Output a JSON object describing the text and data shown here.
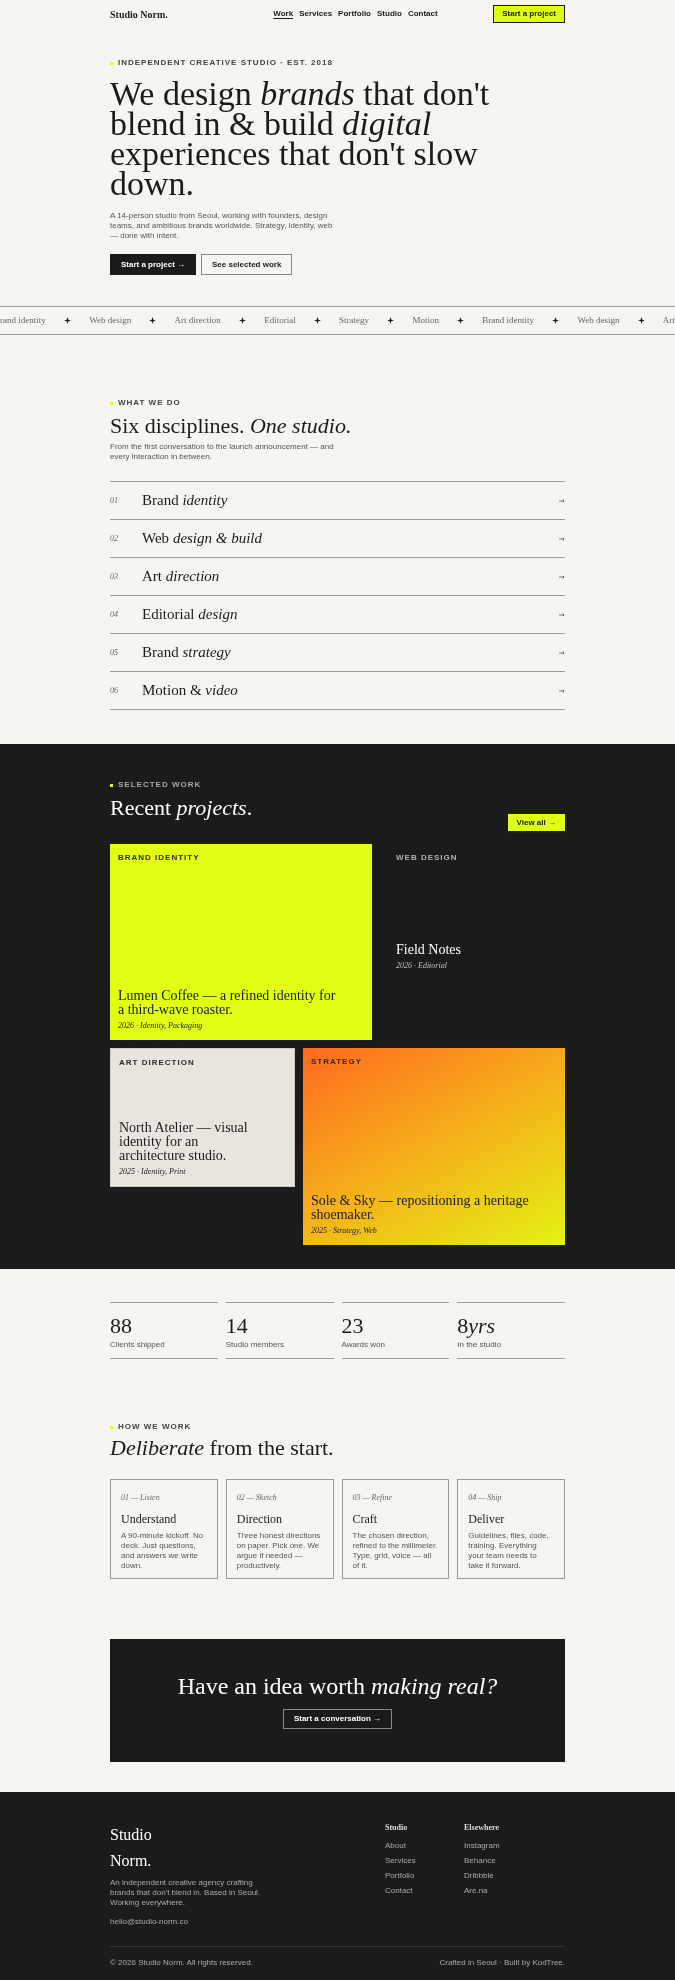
{
  "nav": {
    "logo": "Studio Norm.",
    "links": [
      {
        "label": "Work",
        "selected": true
      },
      {
        "label": "Services",
        "selected": false
      },
      {
        "label": "Portfolio",
        "selected": false
      },
      {
        "label": "Studio",
        "selected": false
      },
      {
        "label": "Contact",
        "selected": false
      }
    ],
    "cta": "Start a project"
  },
  "hero": {
    "eyebrow": "INDEPENDENT CREATIVE STUDIO · EST. 2018",
    "heading": "We design *brands* that don't blend in & build *digital* experiences that don't slow down.",
    "text": "A 14-person studio from Seoul, working with founders, design teams, and ambitious brands worldwide. Strategy, identity, web — done with intent.",
    "buttons": [
      {
        "label": "Start a project →",
        "kind": "primary"
      },
      {
        "label": "See selected work",
        "kind": "outline"
      }
    ]
  },
  "marquee": [
    "rand identity",
    "Web design",
    "Art direction",
    "Editorial",
    "Strategy",
    "Motion",
    "Brand identity",
    "Web design",
    "Art"
  ],
  "services": {
    "eyebrow": "WHAT WE DO",
    "heading": "Six disciplines. *One studio.*",
    "text": "From the first conversation to the launch announcement — and every interaction in between.",
    "items": [
      {
        "number": "01",
        "title": "Brand *identity*"
      },
      {
        "number": "02",
        "title": "Web *design & build*"
      },
      {
        "number": "03",
        "title": "Art *direction*"
      },
      {
        "number": "04",
        "title": "Editorial *design*"
      },
      {
        "number": "05",
        "title": "Brand *strategy*"
      },
      {
        "number": "06",
        "title": "Motion & *video*"
      }
    ]
  },
  "work": {
    "eyebrow": "SELECTED WORK",
    "heading": "Recent *projects*.",
    "button": "View all →",
    "projects": [
      {
        "kind": "lime",
        "category": "BRAND IDENTITY",
        "title": "Lumen Coffee — a refined identity for a third-wave roaster.",
        "meta": "2026 · Identity, Packaging"
      },
      {
        "kind": "dark",
        "category": "WEB DESIGN",
        "title": "Field Notes",
        "meta": "2026 · Editorial"
      },
      {
        "kind": "stone",
        "category": "ART DIRECTION",
        "title": "North Atelier — visual identity for an architecture studio.",
        "meta": "2025 · Identity, Print"
      },
      {
        "kind": "gradient",
        "category": "STRATEGY",
        "title": "Sole & Sky — repositioning a heritage shoemaker.",
        "meta": "2025 · Strategy, Web"
      }
    ]
  },
  "stats": [
    {
      "value": "88",
      "label": "Clients shipped"
    },
    {
      "value": "14",
      "label": "Studio members"
    },
    {
      "value": "23",
      "label": "Awards won"
    },
    {
      "value": "8",
      "unit": "yrs",
      "label": "In the studio"
    }
  ],
  "process": {
    "eyebrow": "HOW WE WORK",
    "heading": "*Deliberate* from the start.",
    "steps": [
      {
        "step": "01 — Listen",
        "title": "Understand",
        "text": "A 90-minute kickoff. No deck. Just questions, and answers we write down."
      },
      {
        "step": "02 — Sketch",
        "title": "Direction",
        "text": "Three honest directions on paper. Pick one. We argue if needed — productively."
      },
      {
        "step": "03 — Refine",
        "title": "Craft",
        "text": "The chosen direction, refined to the millimeter. Type, grid, voice — all of it."
      },
      {
        "step": "04 — Ship",
        "title": "Deliver",
        "text": "Guidelines, files, code, training. Everything your team needs to take it forward."
      }
    ]
  },
  "cta": {
    "heading": "Have an idea worth *making real?*",
    "button": "Start a conversation →"
  },
  "footer": {
    "brand": "Studio Norm.",
    "text": "An independent creative agency crafting brands that don't blend in. Based in Seoul. Working everywhere.",
    "email": "hello@studio-norm.co",
    "columns": [
      {
        "title": "Studio",
        "links": [
          "About",
          "Services",
          "Portfolio",
          "Contact"
        ]
      },
      {
        "title": "Elsewhere",
        "links": [
          "Instagram",
          "Behance",
          "Dribbble",
          "Are.na"
        ]
      }
    ],
    "copyright": "© 2026 Studio Norm. All rights reserved.",
    "credit": "Crafted in Seoul · Built by KodTree."
  }
}
